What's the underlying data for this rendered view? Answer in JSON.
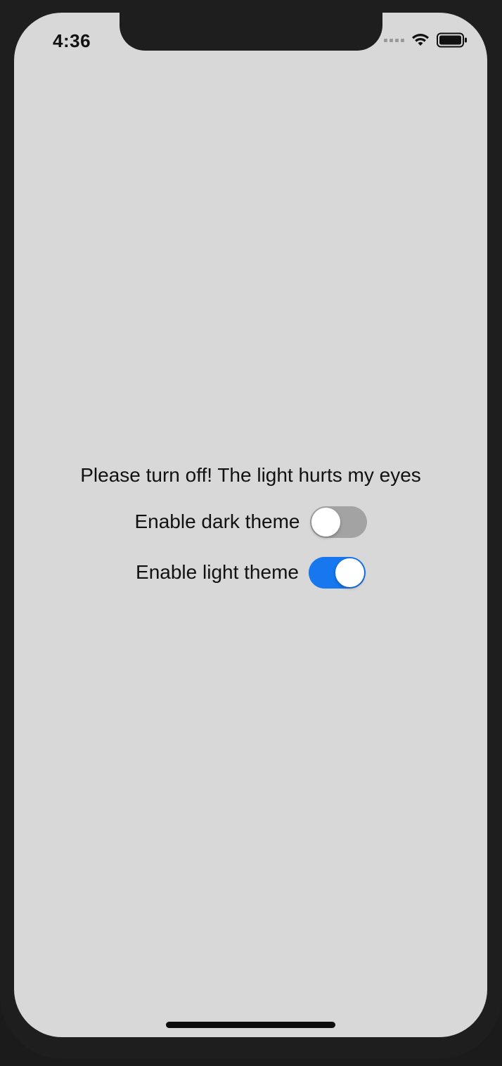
{
  "status_bar": {
    "time": "4:36",
    "icons": [
      "cellular-signal-icon",
      "wifi-icon",
      "battery-icon"
    ]
  },
  "main": {
    "message": "Please turn off! The light hurts my eyes",
    "toggles": [
      {
        "label": "Enable dark theme",
        "state": "off"
      },
      {
        "label": "Enable light theme",
        "state": "on"
      }
    ]
  },
  "colors": {
    "background": "#d8d8d8",
    "switch_on": "#1677ee",
    "switch_off": "#a3a3a3",
    "frame": "#1e1e1e"
  }
}
